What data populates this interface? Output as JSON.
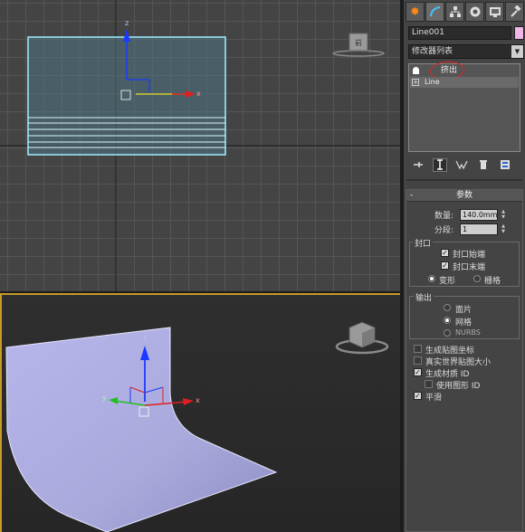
{
  "viewports": {
    "top": {
      "view_cube_label": "前"
    },
    "perspective": {}
  },
  "panel": {
    "tabs": [
      "create",
      "modify",
      "hierarchy",
      "motion",
      "display",
      "utilities"
    ],
    "object_name": "Line001",
    "object_color": "#f0b8e8",
    "modifier_list": "修改器列表",
    "stack": {
      "extrude": "挤出",
      "line": "Line"
    },
    "params": {
      "title": "参数",
      "amount_label": "数量:",
      "amount_value": "140.0mm",
      "segments_label": "分段:",
      "segments_value": "1",
      "capping": {
        "title": "封口",
        "cap_start": "封口始端",
        "cap_end": "封口末端",
        "morph": "变形",
        "grid": "栅格"
      },
      "output": {
        "title": "输出",
        "patch": "面片",
        "mesh": "网格",
        "nurbs": "NURBS"
      },
      "gen_mapping": "生成贴图坐标",
      "real_world": "真实世界贴图大小",
      "gen_mat_ids": "生成材质 ID",
      "use_shape_ids": "使用图形 ID",
      "smooth": "平滑"
    }
  },
  "colors": {
    "selection": "#8be8ff",
    "accent": "#c79b2a",
    "annotation": "#e02525"
  }
}
